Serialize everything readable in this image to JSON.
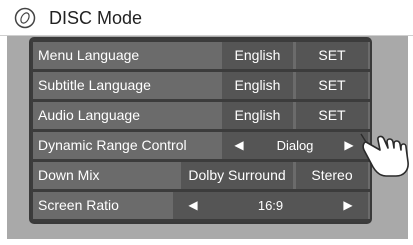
{
  "header": {
    "title": "DISC Mode",
    "icon": "disc-icon"
  },
  "rows": [
    {
      "label": "Menu Language",
      "value": "English",
      "action": "SET"
    },
    {
      "label": "Subtitle Language",
      "value": "English",
      "action": "SET"
    },
    {
      "label": "Audio Language",
      "value": "English",
      "action": "SET"
    },
    {
      "label": "Dynamic Range Control",
      "value": "Dialog",
      "prev": "◀",
      "next": "▶"
    },
    {
      "label": "Down Mix",
      "option_1": "Dolby Surround",
      "option_2": "Stereo"
    },
    {
      "label": "Screen Ratio",
      "value": "16:9",
      "prev": "◀",
      "next": "▶"
    }
  ],
  "colors": {
    "row_bg": "#6b6b6b",
    "button_bg": "#555555",
    "panel_bg": "#a9a9a9",
    "text": "#ffffff"
  }
}
